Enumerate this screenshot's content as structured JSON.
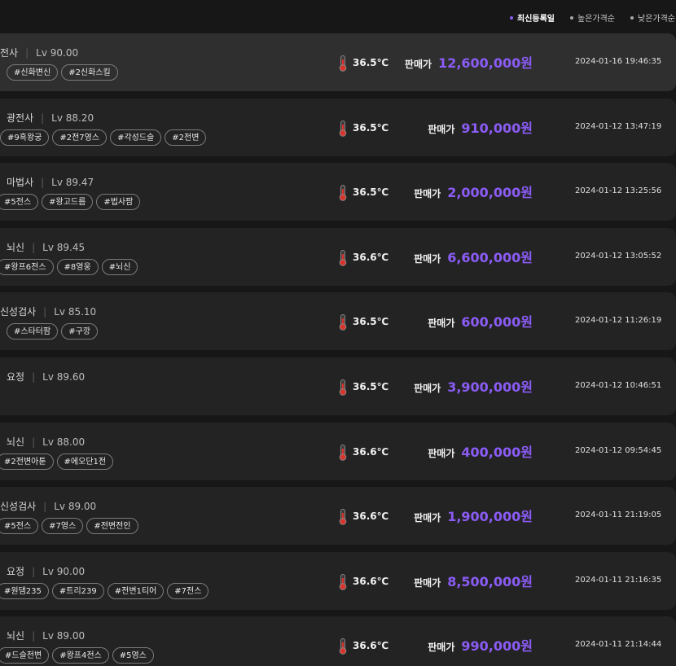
{
  "sort": {
    "options": [
      "최신등록일",
      "높은가격순",
      "낮은가격순"
    ],
    "active_index": 0,
    "accent_color": "#8b5cf6"
  },
  "icons": {
    "temperature": "thermometer-icon"
  },
  "listings": [
    {
      "job": "전사",
      "level": "Lv 90.00",
      "tags": [
        "#신화변신",
        "#2신화스킬"
      ],
      "temp": "36.5℃",
      "price_label": "판매가",
      "price": "12,600,000원",
      "date": "2024-01-16 19:46:35"
    },
    {
      "job": "광전사",
      "level": "Lv 88.20",
      "tags": [
        "#9흑왕궁",
        "#2전7영스",
        "#각성드슬",
        "#2전변"
      ],
      "temp": "36.5℃",
      "price_label": "판매가",
      "price": "910,000원",
      "date": "2024-01-12 13:47:19"
    },
    {
      "job": "마법사",
      "level": "Lv 89.47",
      "tags": [
        "#5전스",
        "#왕고드름",
        "#법사팜"
      ],
      "temp": "36.5℃",
      "price_label": "판매가",
      "price": "2,000,000원",
      "date": "2024-01-12 13:25:56"
    },
    {
      "job": "뇌신",
      "level": "Lv 89.45",
      "tags": [
        "#왕프6전스",
        "#8영웅",
        "#뇌신"
      ],
      "temp": "36.6℃",
      "price_label": "판매가",
      "price": "6,600,000원",
      "date": "2024-01-12 13:05:52"
    },
    {
      "job": "신성검사",
      "level": "Lv 85.10",
      "tags": [
        "#스타터팜",
        "#구깡"
      ],
      "temp": "36.5℃",
      "price_label": "판매가",
      "price": "600,000원",
      "date": "2024-01-12 11:26:19"
    },
    {
      "job": "요정",
      "level": "Lv 89.60",
      "tags": [],
      "temp": "36.5℃",
      "price_label": "판매가",
      "price": "3,900,000원",
      "date": "2024-01-12 10:46:51"
    },
    {
      "job": "뇌신",
      "level": "Lv 88.00",
      "tags": [
        "#2전변아툰",
        "#에오단1전"
      ],
      "temp": "36.6℃",
      "price_label": "판매가",
      "price": "400,000원",
      "date": "2024-01-12 09:54:45"
    },
    {
      "job": "신성검사",
      "level": "Lv 89.00",
      "tags": [
        "#5전스",
        "#7영스",
        "#전변전인"
      ],
      "temp": "36.6℃",
      "price_label": "판매가",
      "price": "1,900,000원",
      "date": "2024-01-11 21:19:05"
    },
    {
      "job": "요정",
      "level": "Lv 90.00",
      "tags": [
        "#원댐235",
        "#트리239",
        "#전변1티어",
        "#7전스"
      ],
      "temp": "36.6℃",
      "price_label": "판매가",
      "price": "8,500,000원",
      "date": "2024-01-11 21:16:35"
    },
    {
      "job": "뇌신",
      "level": "Lv 89.00",
      "tags": [
        "#드슬전변",
        "#왕프4전스",
        "#5영스"
      ],
      "temp": "36.6℃",
      "price_label": "판매가",
      "price": "990,000원",
      "date": "2024-01-11 21:14:44"
    }
  ]
}
